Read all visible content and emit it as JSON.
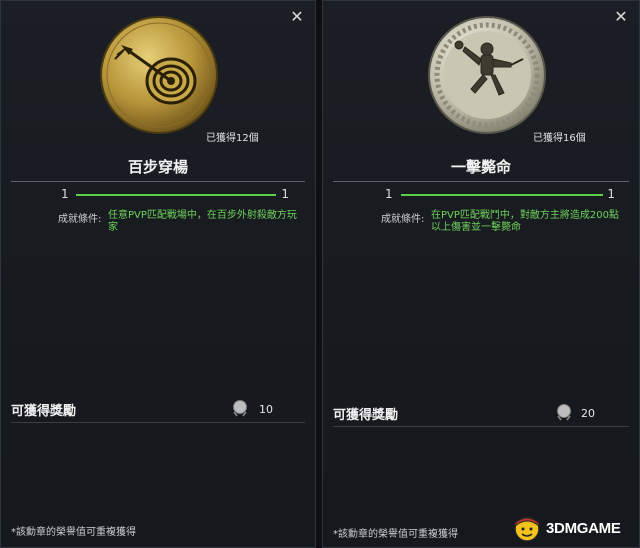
{
  "panels": [
    {
      "obtained": "已獲得12個",
      "title": "百步穿楊",
      "progress": {
        "current": "1",
        "target": "1",
        "fraction": 1.0
      },
      "condition_label": "成就條件:",
      "condition_text": "任意PVP匹配戰場中，在百步外射殺敵方玩家",
      "reward_label": "可獲得獎勵",
      "reward_value": "10",
      "footnote": "*該勳章的榮譽值可重複獲得",
      "medal_icon": "target-arrow-medal-icon"
    },
    {
      "obtained": "已獲得16個",
      "title": "一擊斃命",
      "progress": {
        "current": "1",
        "target": "1",
        "fraction": 1.0
      },
      "condition_label": "成就條件:",
      "condition_text": "在PVP匹配戰鬥中，對敵方主將造成200點以上傷害並一擊斃命",
      "reward_label": "可獲得獎勵",
      "reward_value": "20",
      "footnote": "*該勳章的榮譽值可重複獲得",
      "medal_icon": "warrior-silver-medal-icon"
    }
  ],
  "watermark": "3DMGAME",
  "colors": {
    "progress": "#5bd14a",
    "condition": "#6fd35b",
    "gold_medal": "#c9a94a",
    "silver_medal": "#c8c6b8"
  }
}
